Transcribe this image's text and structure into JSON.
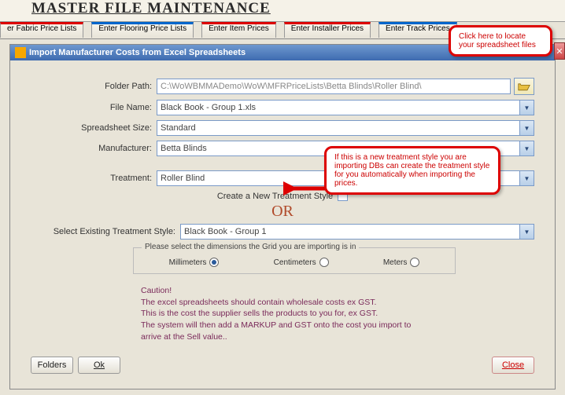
{
  "header": {
    "title": "MASTER FILE MAINTENANCE"
  },
  "tabs": {
    "t0": "er Fabric Price Lists",
    "t1": "Enter Flooring Price Lists",
    "t2": "Enter Item Prices",
    "t3": "Enter Installer Prices",
    "t4": "Enter Track Prices"
  },
  "dialog": {
    "title": "Import Manufacturer Costs from Excel Spreadsheets",
    "folder_path_label": "Folder Path:",
    "folder_path_value": "C:\\WoWBMMADemo\\WoW\\MFRPriceLists\\Betta Blinds\\Roller Blind\\",
    "file_name_label": "File Name:",
    "file_name_value": "Black Book - Group 1.xls",
    "spreadsheet_size_label": "Spreadsheet Size:",
    "spreadsheet_size_value": "Standard",
    "manufacturer_label": "Manufacturer:",
    "manufacturer_value": "Betta Blinds",
    "treatment_label": "Treatment:",
    "treatment_value": "Roller Blind",
    "create_style_label": "Create a New Treatment Style",
    "or_text": "OR",
    "select_existing_label": "Select Existing Treatment Style:",
    "select_existing_value": "Black Book - Group 1",
    "dim_legend": "Please select the dimensions the Grid you are importing is in",
    "dim_mm": "Millimeters",
    "dim_cm": "Centimeters",
    "dim_m": "Meters",
    "caution_title": "Caution!",
    "caution_l1": "The excel spreadsheets should contain wholesale costs ex GST.",
    "caution_l2": "This is the cost the supplier sells the products to you for, ex GST.",
    "caution_l3": "The system will then add a MARKUP and GST onto the cost you import to",
    "caution_l4": "arrive at the Sell value..",
    "btn_folders": "Folders",
    "btn_ok": "Ok",
    "btn_close": "Close"
  },
  "callouts": {
    "c1": "Click here to locate your spreadsheet files",
    "c2": "If this is a new treatment style you are importing DBs can create the treatment style for you automatically when importing the prices."
  }
}
